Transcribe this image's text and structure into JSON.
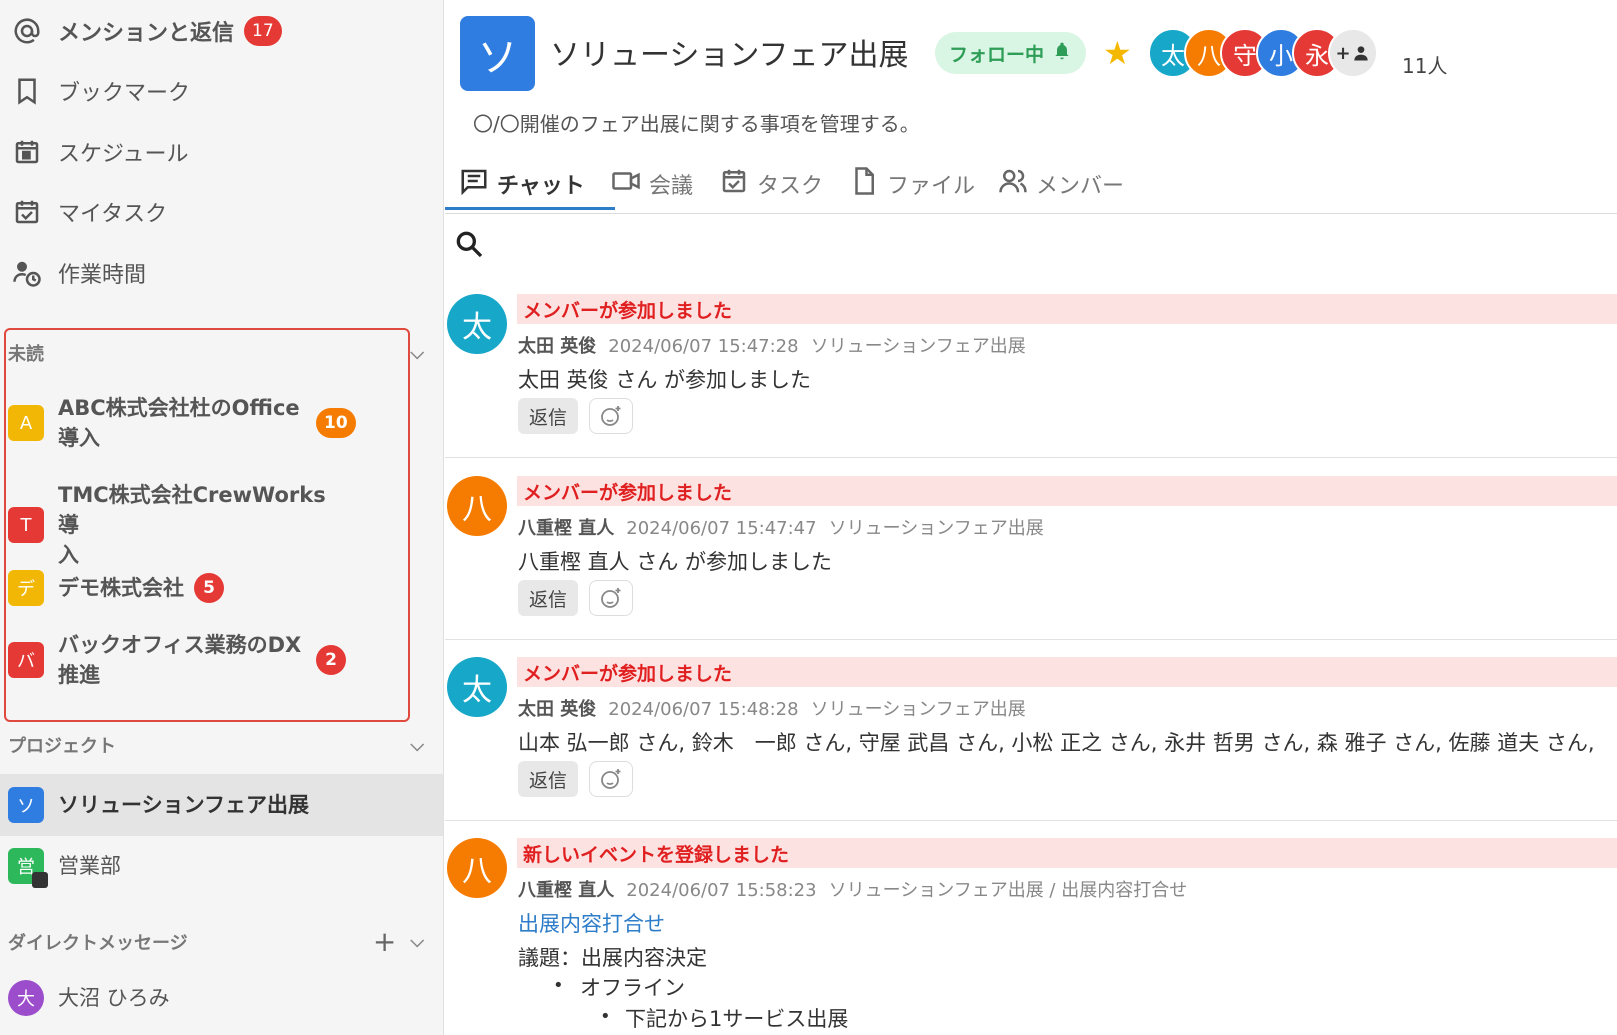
{
  "sidebar": {
    "nav": [
      {
        "label": "メンションと返信",
        "badge": "17",
        "icon": "at-icon"
      },
      {
        "label": "ブックマーク",
        "icon": "bookmark-icon"
      },
      {
        "label": "スケジュール",
        "icon": "calendar-icon"
      },
      {
        "label": "マイタスク",
        "icon": "task-check-icon"
      },
      {
        "label": "作業時間",
        "icon": "person-clock-icon"
      }
    ],
    "unread": {
      "title": "未読",
      "items": [
        {
          "avatar": "A",
          "color": "#f2b705",
          "line1": "ABC株式会社杜のOffice",
          "line2": "導入",
          "badge": "10"
        },
        {
          "avatar": "T",
          "color": "#e53935",
          "line1": "TMC株式会社CrewWorks導",
          "line2": "入"
        },
        {
          "avatar": "デ",
          "color": "#f2b705",
          "line1": "デモ株式会社",
          "badge": "5"
        },
        {
          "avatar": "バ",
          "color": "#e53935",
          "line1": "バックオフィス業務のDX",
          "line2": "推進",
          "badge": "2"
        }
      ]
    },
    "projects": {
      "title": "プロジェクト",
      "items": [
        {
          "avatar": "ソ",
          "color": "#2f7de1",
          "label": "ソリューションフェア出展"
        },
        {
          "avatar": "営",
          "color": "#2eb85c",
          "label": "営業部"
        }
      ]
    },
    "dm": {
      "title": "ダイレクトメッセージ",
      "items": [
        {
          "avatar": "大",
          "color": "#9c4dcc",
          "label": "大沼 ひろみ"
        }
      ]
    }
  },
  "channel": {
    "avatar": "ソ",
    "title": "ソリューションフェア出展",
    "follow_label": "フォロー中",
    "star": "★",
    "members": [
      {
        "char": "太",
        "color": "#17a7c8"
      },
      {
        "char": "八",
        "color": "#f57c00"
      },
      {
        "char": "守",
        "color": "#e53935"
      },
      {
        "char": "小",
        "color": "#2f7de1"
      },
      {
        "char": "永",
        "color": "#e53935"
      }
    ],
    "add_member_icon": "+",
    "member_count": "11人",
    "description": "〇/〇開催のフェア出展に関する事項を管理する。"
  },
  "tabs": [
    {
      "label": "チャット",
      "icon": "chat-icon",
      "active": true
    },
    {
      "label": "会議",
      "icon": "video-icon"
    },
    {
      "label": "タスク",
      "icon": "task-icon"
    },
    {
      "label": "ファイル",
      "icon": "file-icon"
    },
    {
      "label": "メンバー",
      "icon": "members-icon"
    }
  ],
  "messages": [
    {
      "avatar": "太",
      "color": "#17a7c8",
      "banner": "メンバーが参加しました",
      "author": "太田 英俊",
      "time": "2024/06/07 15:47:28",
      "channel": "ソリューションフェア出展",
      "body": "太田 英俊 さん が参加しました",
      "reply": "返信"
    },
    {
      "avatar": "八",
      "color": "#f57c00",
      "banner": "メンバーが参加しました",
      "author": "八重樫 直人",
      "time": "2024/06/07 15:47:47",
      "channel": "ソリューションフェア出展",
      "body": "八重樫 直人 さん が参加しました",
      "reply": "返信"
    },
    {
      "avatar": "太",
      "color": "#17a7c8",
      "banner": "メンバーが参加しました",
      "author": "太田 英俊",
      "time": "2024/06/07 15:48:28",
      "channel": "ソリューションフェア出展",
      "body": "山本 弘一郎 さん, 鈴木　一郎 さん, 守屋 武昌 さん, 小松 正之 さん, 永井 哲男 さん, 森 雅子 さん, 佐藤 道夫 さん,",
      "reply": "返信"
    },
    {
      "avatar": "八",
      "color": "#f57c00",
      "banner": "新しいイベントを登録しました",
      "author": "八重樫 直人",
      "time": "2024/06/07 15:58:23",
      "channel": "ソリューションフェア出展 / 出展内容打合せ",
      "link": "出展内容打合せ",
      "agenda": "議題：出展内容決定",
      "b1": "オフライン",
      "b2": "下記から1サービス出展"
    }
  ]
}
